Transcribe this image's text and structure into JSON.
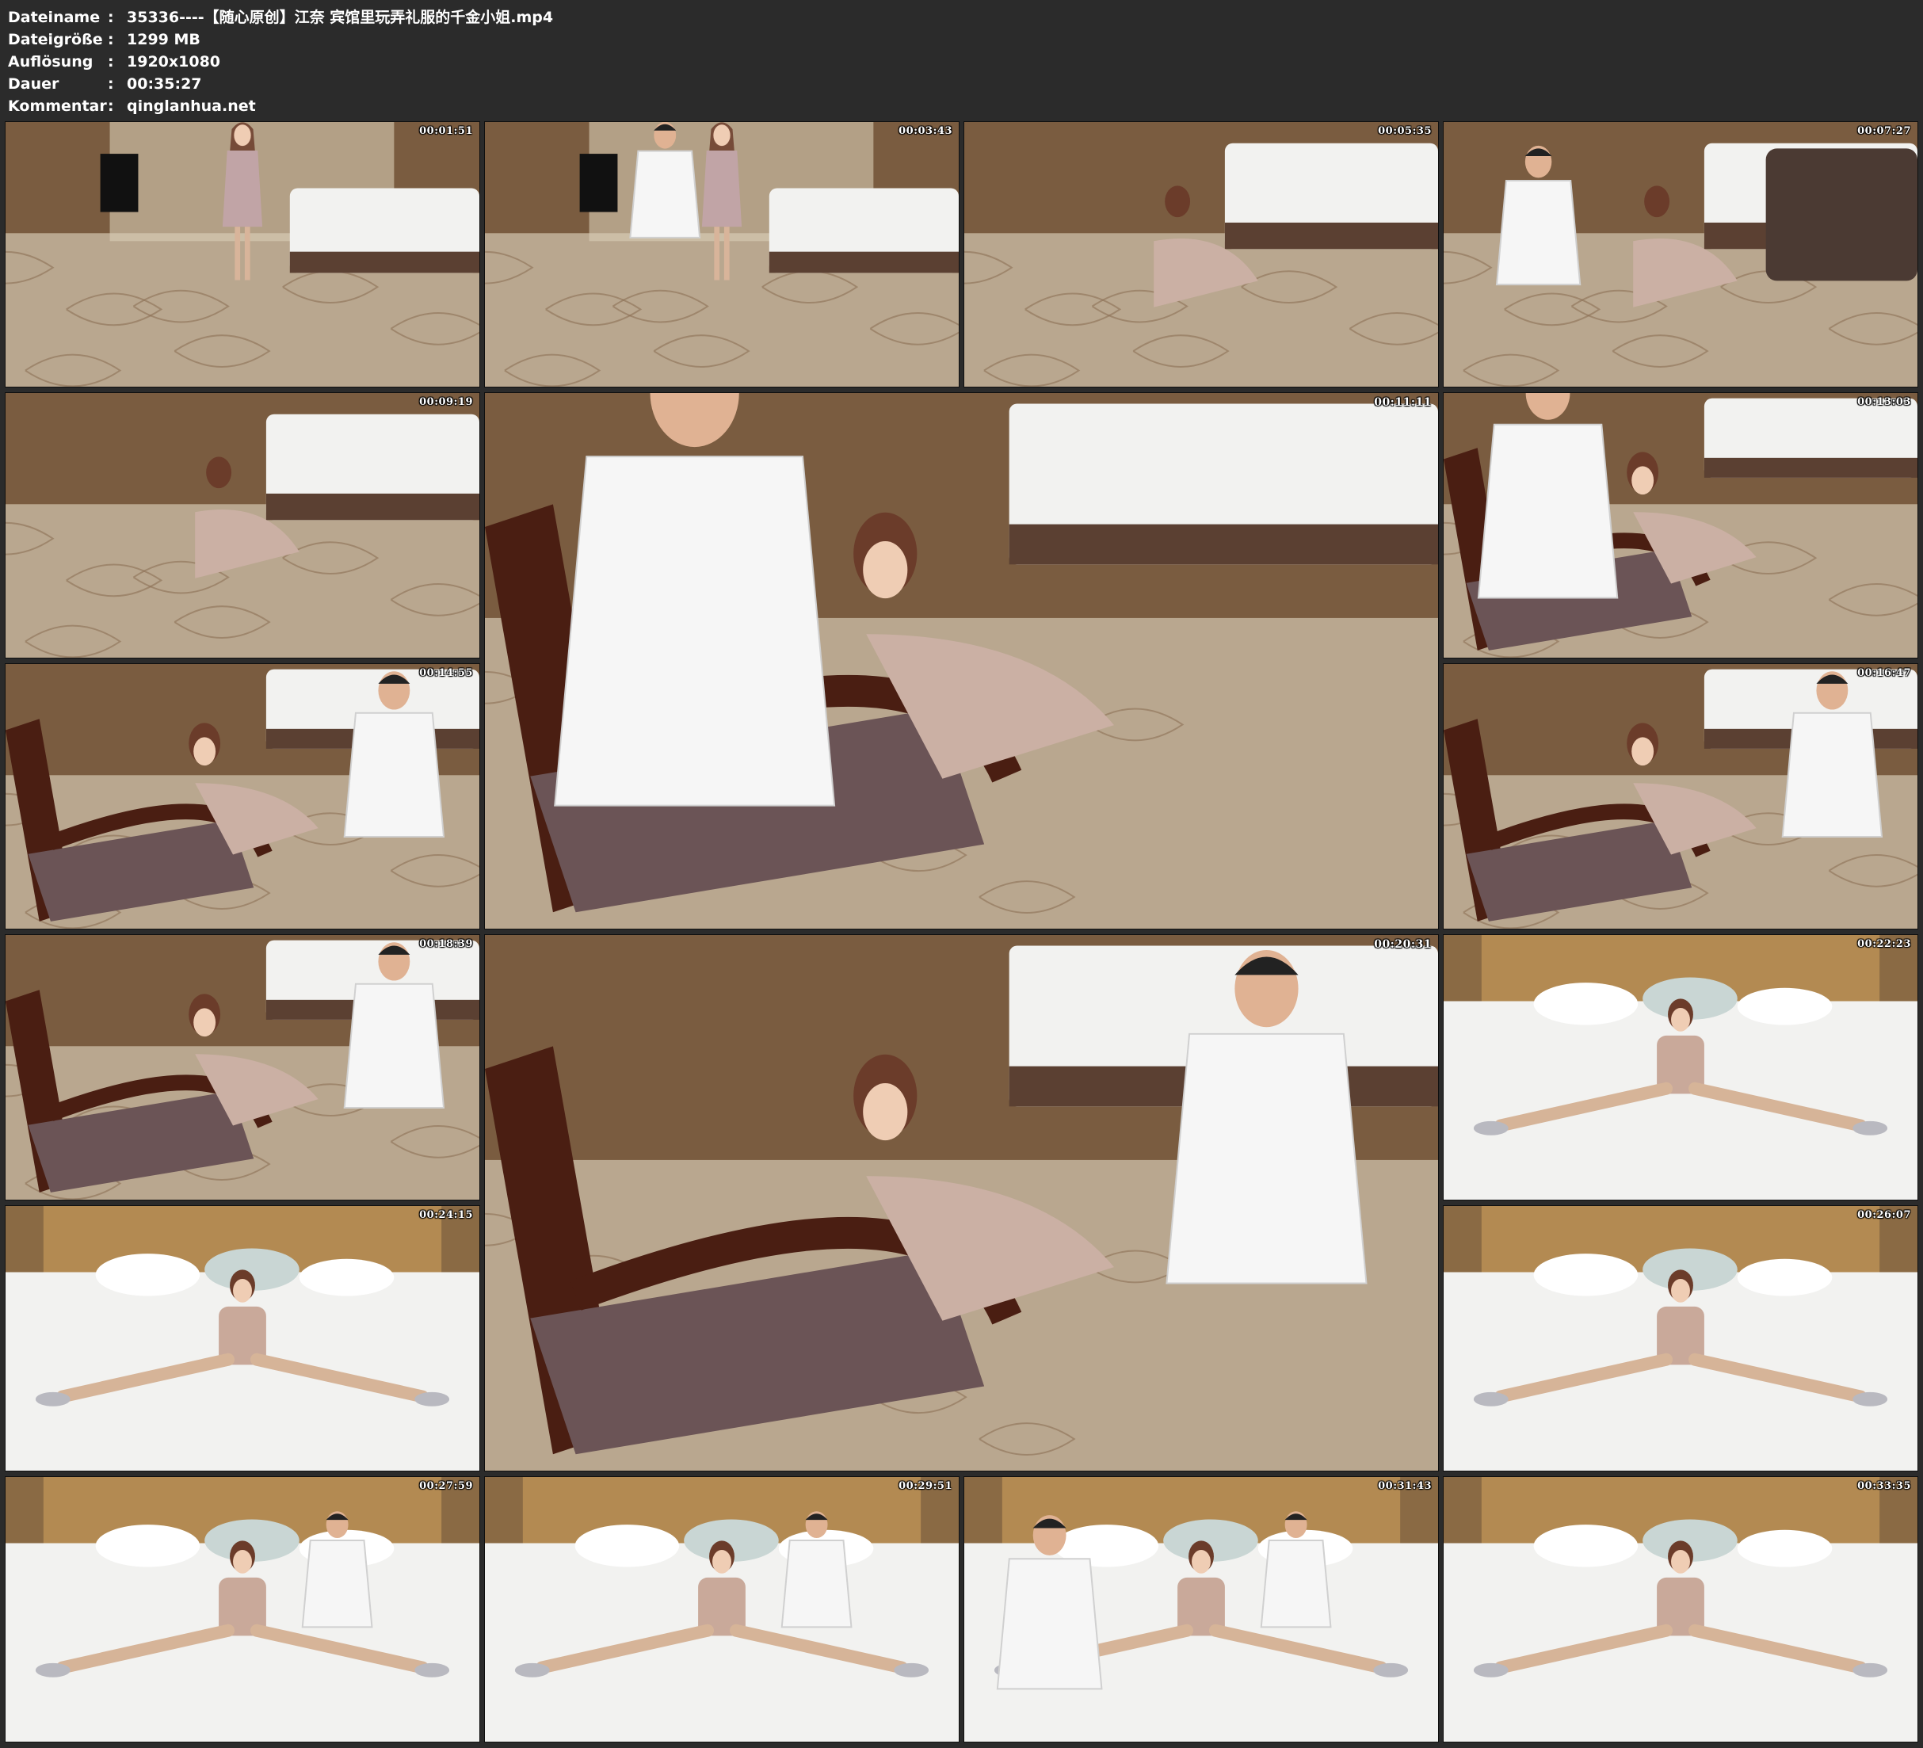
{
  "header": {
    "rows": [
      {
        "label": "Dateiname",
        "sep": ":",
        "value": "35336----【随心原创】江奈 宾馆里玩弄礼服的千金小姐.mp4"
      },
      {
        "label": "Dateigröße",
        "sep": ":",
        "value": "1299 MB"
      },
      {
        "label": "Auflösung",
        "sep": ":",
        "value": "1920x1080"
      },
      {
        "label": "Dauer",
        "sep": ":",
        "value": "00:35:27"
      },
      {
        "label": "Kommentar",
        "sep": ":",
        "value": "qinglanhua.net"
      }
    ]
  },
  "thumbnails": [
    {
      "timestamp": "00:01:51",
      "scene": "room-standing"
    },
    {
      "timestamp": "00:03:43",
      "scene": "room-two-standing"
    },
    {
      "timestamp": "00:05:35",
      "scene": "floor-kneeling"
    },
    {
      "timestamp": "00:07:27",
      "scene": "floor-closeup-sofa"
    },
    {
      "timestamp": "00:09:19",
      "scene": "floor-drinking"
    },
    {
      "timestamp": "00:11:11",
      "scene": "large-chair-closeup"
    },
    {
      "timestamp": "00:13:03",
      "scene": "chair-closeup"
    },
    {
      "timestamp": "00:14:55",
      "scene": "chair-kneeling"
    },
    {
      "timestamp": "00:16:47",
      "scene": "chair-kneeling-phone"
    },
    {
      "timestamp": "00:18:39",
      "scene": "chair-kneeling-man"
    },
    {
      "timestamp": "00:20:31",
      "scene": "large-chair-kneeling"
    },
    {
      "timestamp": "00:22:23",
      "scene": "bed-lying"
    },
    {
      "timestamp": "00:24:15",
      "scene": "bed-lying-close"
    },
    {
      "timestamp": "00:26:07",
      "scene": "bed-lying"
    },
    {
      "timestamp": "00:27:59",
      "scene": "bed-man"
    },
    {
      "timestamp": "00:29:51",
      "scene": "bed-man"
    },
    {
      "timestamp": "00:31:43",
      "scene": "bed-man-close"
    },
    {
      "timestamp": "00:33:35",
      "scene": "bed-lying"
    }
  ],
  "colors": {
    "background": "#2b2b2b",
    "header_text": "#ffffff",
    "carpet": "#b9a78f",
    "wall": "#7a5c40",
    "bed": "#f2f2f0"
  }
}
